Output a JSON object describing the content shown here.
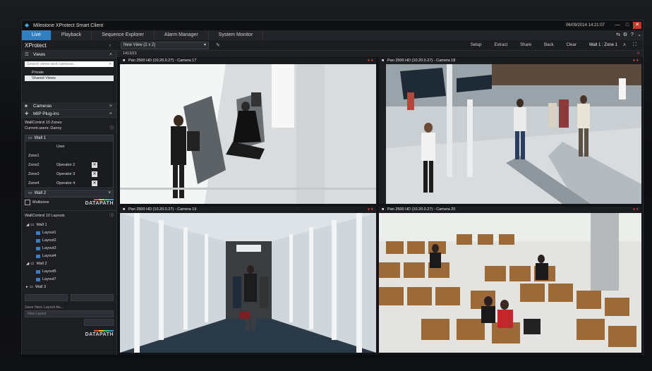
{
  "app": {
    "title": "Milestone XProtect Smart Client",
    "clock": "06/09/2014 14:21:07"
  },
  "tabs": [
    "Live",
    "Playback",
    "Sequence Explorer",
    "Alarm Manager",
    "System Monitor"
  ],
  "toolbar": {
    "product": "XProtect",
    "view_selector": "New View (2 x 2)",
    "buttons": [
      "Setup",
      "Extract",
      "Share",
      "Back",
      "Clear"
    ],
    "wall_selector": "Wall 1 : Zone 1"
  },
  "left": {
    "views_title": "Views",
    "search_placeholder": "Search views and cameras...",
    "views": [
      "Private",
      "Shared Views"
    ],
    "cameras_title": "Cameras",
    "mip_title": "MIP Plug-ins",
    "wallcontrol_title": "WallControl 10 Zones",
    "current_users": "Current users: Danny",
    "wall1": "Wall 1",
    "user_header": "User",
    "zones": [
      {
        "name": "Zone1",
        "user": ""
      },
      {
        "name": "Zone2",
        "user": "Operator 2"
      },
      {
        "name": "Zone3",
        "user": "Operator 3"
      },
      {
        "name": "Zone4",
        "user": "Operator 4"
      }
    ],
    "wall2": "Wall 2",
    "multizone": "Multizone",
    "datapath": "DATAPATH",
    "layouts_title": "WallControl 10 Layouts",
    "layout_tree": [
      {
        "wall": "Wall 1",
        "layouts": [
          "Layout1",
          "Layout2",
          "Layout3",
          "Layout4"
        ]
      },
      {
        "wall": "Wall 2",
        "layouts": [
          "Layout5",
          "Layout7"
        ]
      },
      {
        "wall": "Wall 3",
        "layouts": []
      }
    ],
    "save_layout": "Save New Layout As...",
    "new_layout_placeholder": "New Layout"
  },
  "view": {
    "header": "1413/21",
    "cameras": [
      {
        "title": "Pan 2500 HD (10.20.0.27) - Camera 17"
      },
      {
        "title": "Pan 2500 HD (10.20.0.27) - Camera 18"
      },
      {
        "title": "Pan 2500 HD (10.20.0.27) - Camera 19"
      },
      {
        "title": "Pan 2500 HD (10.20.0.27) - Camera 20"
      }
    ]
  },
  "colors": {
    "accent": "#2f7fc1",
    "record": "#e0483a"
  }
}
